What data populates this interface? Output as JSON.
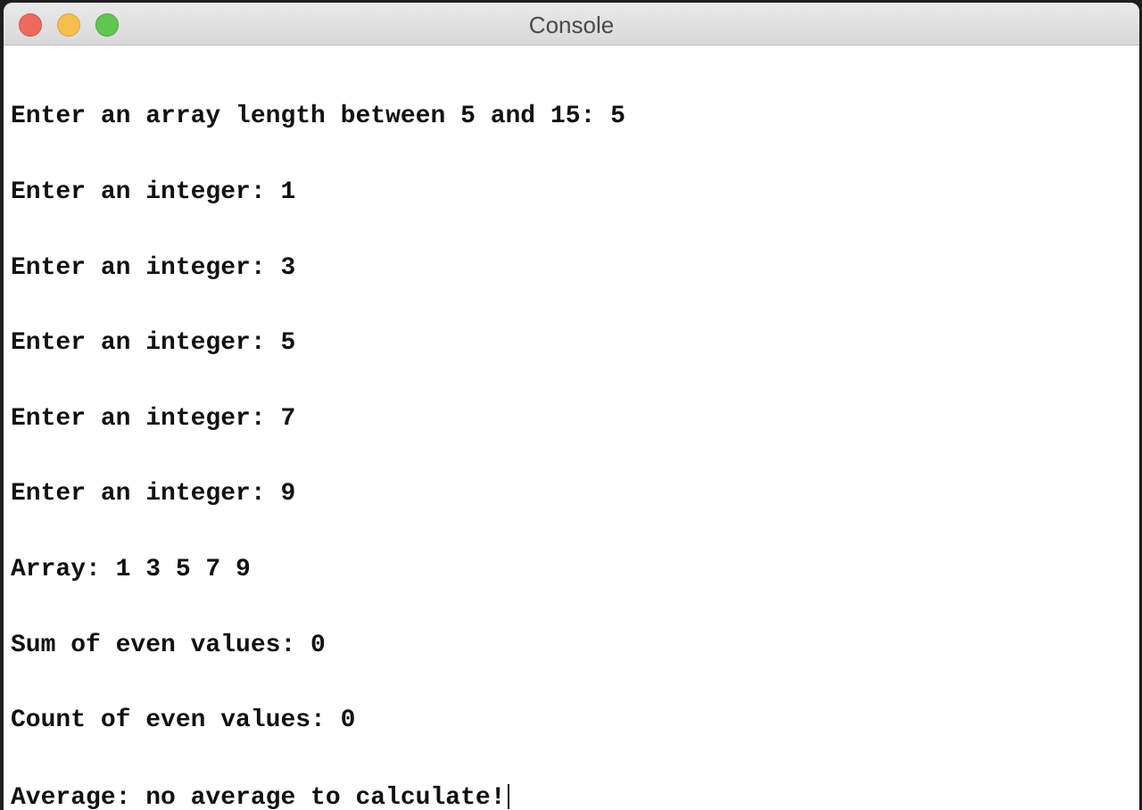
{
  "window": {
    "title": "Console",
    "controls": {
      "close": "close-button",
      "minimize": "minimize-button",
      "zoom": "zoom-button"
    }
  },
  "console": {
    "lines": [
      "Enter an array length between 5 and 15: 5",
      "Enter an integer: 1",
      "Enter an integer: 3",
      "Enter an integer: 5",
      "Enter an integer: 7",
      "Enter an integer: 9",
      "Array: 1 3 5 7 9",
      "Sum of even values: 0",
      "Count of even values: 0",
      "Average: no average to calculate!"
    ]
  }
}
